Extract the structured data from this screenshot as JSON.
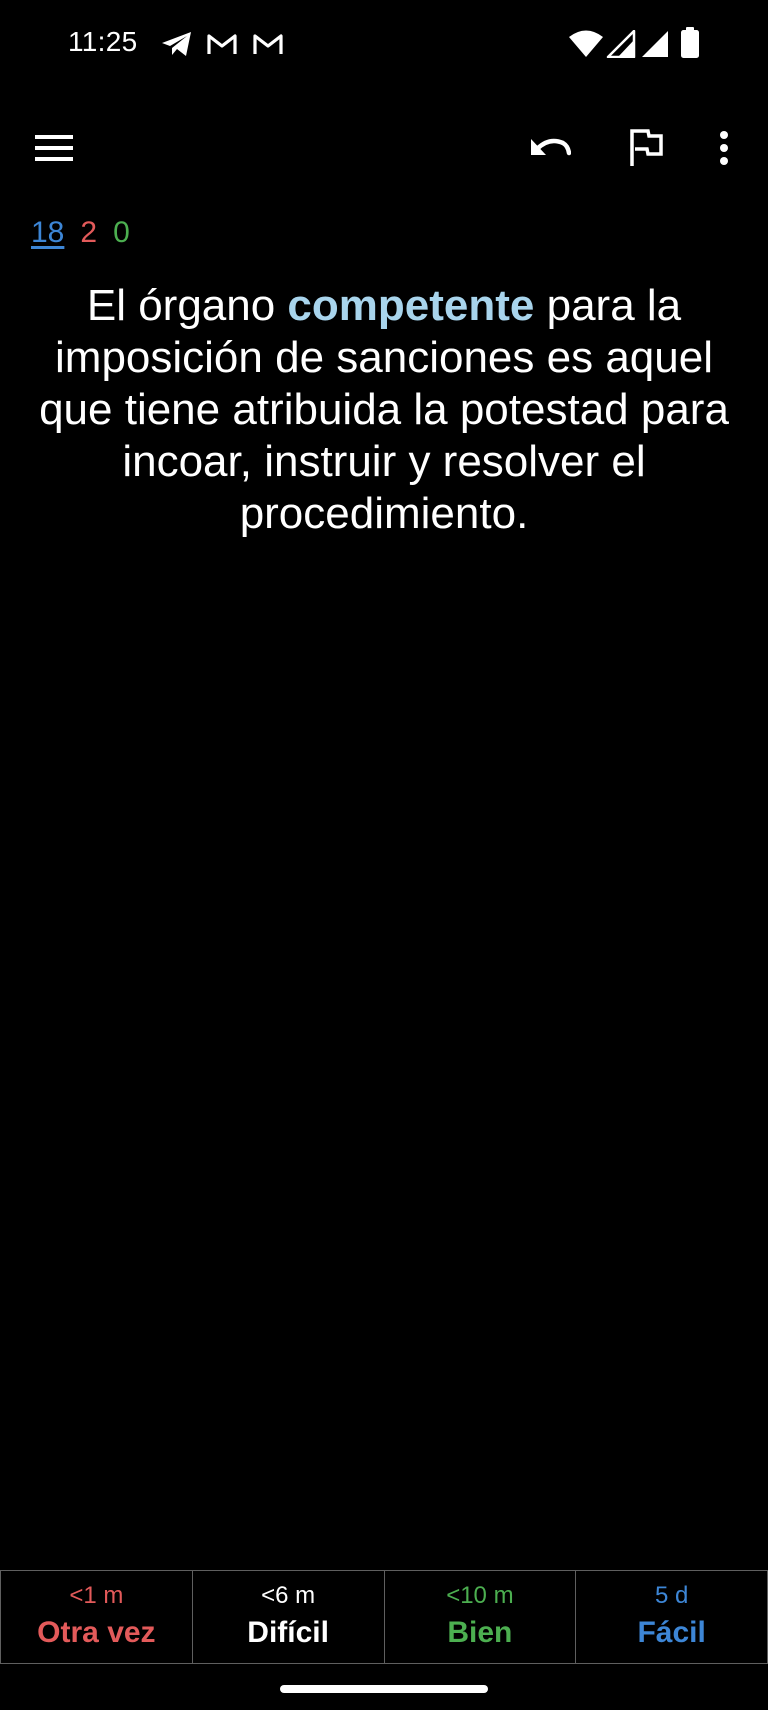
{
  "status_bar": {
    "time": "11:25",
    "notification_icons": [
      "telegram-icon",
      "gmail-icon",
      "gmail-icon"
    ],
    "system_icons": [
      "wifi-icon",
      "signal-icon",
      "signal-icon",
      "battery-icon"
    ]
  },
  "toolbar": {
    "menu_icon": "hamburger-menu-icon",
    "undo_icon": "undo-icon",
    "flag_icon": "flag-icon",
    "overflow_icon": "more-vert-icon"
  },
  "counts": {
    "new": "18",
    "learning": "2",
    "review": "0"
  },
  "card": {
    "text_before": "El órgano ",
    "highlight": "competente",
    "text_after": " para la imposición de sanciones es aquel que tiene atribuida la potestad para incoar, instruir y resolver el procedimiento."
  },
  "answer_buttons": [
    {
      "time": "<1 m",
      "label": "Otra vez"
    },
    {
      "time": "<6 m",
      "label": "Difícil"
    },
    {
      "time": "<10 m",
      "label": "Bien"
    },
    {
      "time": "5 d",
      "label": "Fácil"
    }
  ],
  "colors": {
    "background": "#000000",
    "again": "#e35a5a",
    "hard": "#ffffff",
    "good": "#4caf50",
    "easy": "#3d86d6",
    "highlight": "#a8d4ec"
  }
}
